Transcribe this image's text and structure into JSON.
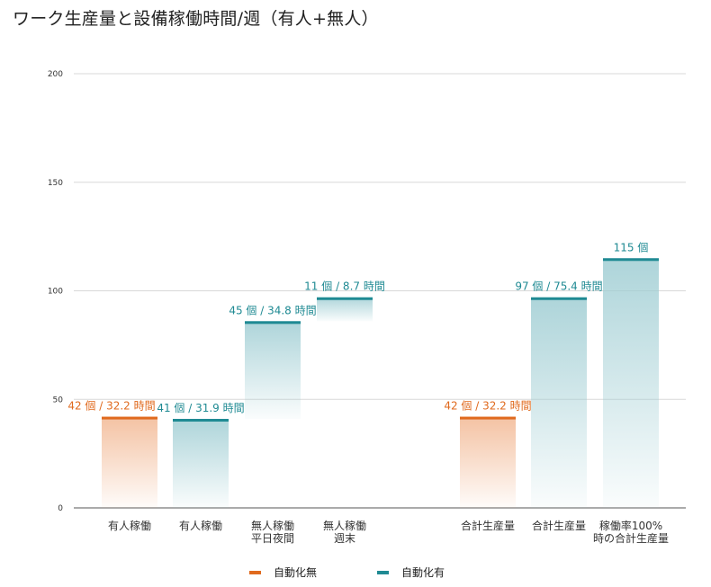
{
  "chart_data": {
    "type": "bar",
    "title": "ワーク生産量と設備稼働時間/週（有人+無人）",
    "ylim": [
      0,
      200
    ],
    "yticks": [
      0,
      50,
      100,
      150,
      200
    ],
    "grid": true,
    "legend_position": "bottom",
    "colors": {
      "manual": "#e06a1e",
      "auto": "#1f8a93"
    },
    "bars": [
      {
        "category": [
          "有人稼働"
        ],
        "series": "manual",
        "base": 0,
        "value": 42,
        "label": "42 個 / 32.2 時間"
      },
      {
        "category": [
          "有人稼働"
        ],
        "series": "auto",
        "base": 0,
        "value": 41,
        "label": "41 個 / 31.9 時間"
      },
      {
        "category": [
          "無人稼働",
          "平日夜間"
        ],
        "series": "auto",
        "base": 41,
        "value": 86,
        "label": "45 個 / 34.8 時間"
      },
      {
        "category": [
          "無人稼働",
          "週末"
        ],
        "series": "auto",
        "base": 86,
        "value": 97,
        "label": "11 個 / 8.7 時間"
      },
      {
        "category": [
          "合計生産量"
        ],
        "series": "manual",
        "base": 0,
        "value": 42,
        "label": "42 個 / 32.2 時間"
      },
      {
        "category": [
          "合計生産量"
        ],
        "series": "auto",
        "base": 0,
        "value": 97,
        "label": "97 個 / 75.4 時間"
      },
      {
        "category": [
          "稼働率100%",
          "時の合計生産量"
        ],
        "series": "auto",
        "base": 0,
        "value": 115,
        "label": "115 個"
      }
    ],
    "legend": [
      {
        "series": "manual",
        "name": "自動化無"
      },
      {
        "series": "auto",
        "name": "自動化有"
      }
    ]
  }
}
